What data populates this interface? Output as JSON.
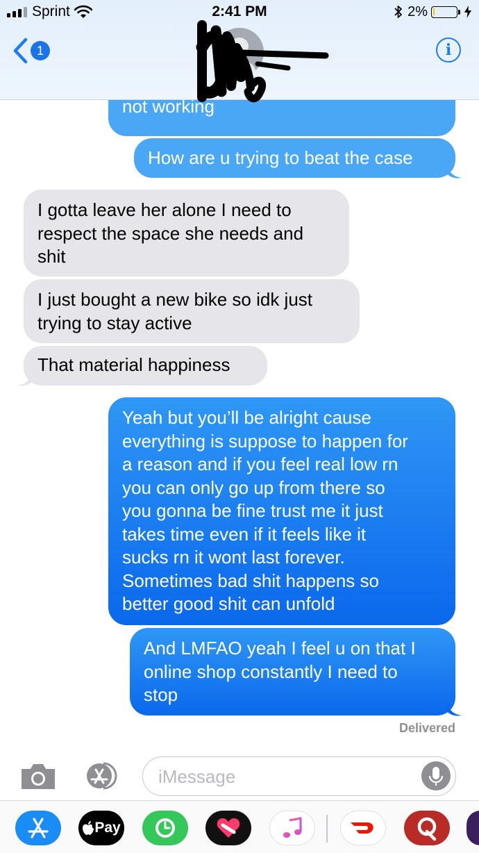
{
  "status_bar": {
    "carrier": "Sprint",
    "time": "2:41 PM",
    "battery_percent": "2%",
    "battery_level": 0.02
  },
  "header": {
    "back_badge": "1",
    "info_icon": "info-icon"
  },
  "messages": [
    {
      "dir": "out",
      "lines": [
        "not working"
      ]
    },
    {
      "dir": "out",
      "lines": [
        "How are u trying to beat the case"
      ]
    },
    {
      "dir": "in",
      "lines": [
        "I gotta leave her alone I need to",
        "respect the space she needs and",
        "shit"
      ]
    },
    {
      "dir": "in",
      "lines": [
        "I just bought a new bike so idk just",
        "trying to stay active"
      ]
    },
    {
      "dir": "in",
      "lines": [
        "That material happiness"
      ]
    },
    {
      "dir": "out",
      "lines": [
        "Yeah but you’ll be alright cause",
        "everything is suppose to happen for",
        "a reason and if you feel real low rn",
        "you can only go up from there so",
        "you gonna be fine trust me it just",
        "takes time even if it feels like it",
        "sucks rn it wont last forever.",
        "Sometimes bad shit happens so",
        "better good shit can unfold"
      ]
    },
    {
      "dir": "out",
      "lines": [
        "And LMFAO yeah I feel u on that I",
        "online shop constantly I need to",
        "stop"
      ]
    }
  ],
  "delivered_label": "Delivered",
  "compose": {
    "placeholder": "iMessage"
  },
  "drawer": {
    "apple_pay_label": "Pay",
    "apps": [
      "app-store-icon",
      "apple-pay-icon",
      "activity-icon",
      "heart-stickers-icon",
      "music-icon",
      "doordash-icon",
      "quora-icon",
      "app-icon-partial"
    ]
  },
  "colors": {
    "ios_blue": "#1a7bf2",
    "incoming_bubble": "#e5e5ea",
    "outgoing_light": "#4aa7f5",
    "outgoing_dark": "#0a68ec"
  }
}
